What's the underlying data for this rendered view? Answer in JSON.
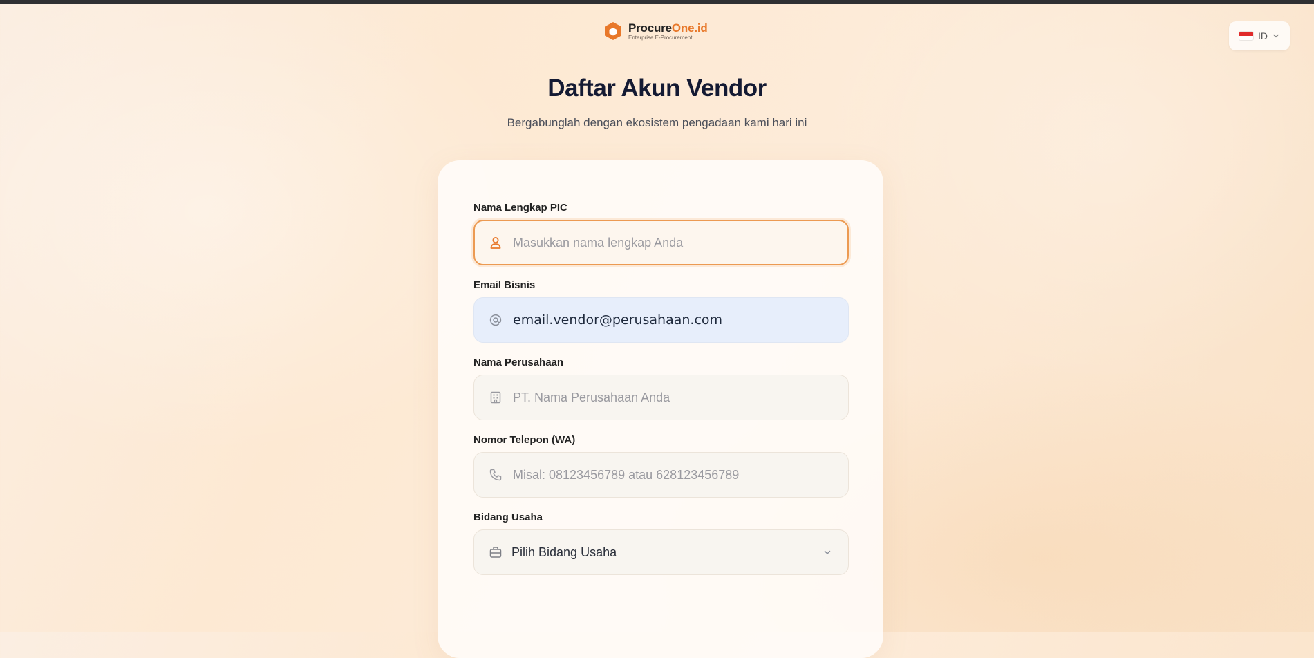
{
  "brand": {
    "name_part1": "Procure",
    "name_part2": "One.id",
    "tagline": "Enterprise E-Procurement"
  },
  "language": {
    "selected": "ID"
  },
  "header": {
    "title": "Daftar Akun Vendor",
    "subtitle": "Bergabunglah dengan ekosistem pengadaan kami hari ini"
  },
  "form": {
    "pic_name": {
      "label": "Nama Lengkap PIC",
      "placeholder": "Masukkan nama lengkap Anda",
      "value": ""
    },
    "email": {
      "label": "Email Bisnis",
      "placeholder": "",
      "value": "email.vendor@perusahaan.com"
    },
    "company": {
      "label": "Nama Perusahaan",
      "placeholder": "PT. Nama Perusahaan Anda",
      "value": ""
    },
    "phone": {
      "label": "Nomor Telepon (WA)",
      "placeholder": "Misal: 08123456789 atau 628123456789",
      "value": ""
    },
    "business": {
      "label": "Bidang Usaha",
      "selected": "Pilih Bidang Usaha"
    }
  },
  "colors": {
    "accent": "#e8782a",
    "focus_border": "#ec9a52",
    "title": "#141a33"
  },
  "icons": {
    "pic_name": "user-icon",
    "email": "at-icon",
    "company": "building-icon",
    "phone": "phone-icon",
    "business": "briefcase-icon"
  }
}
